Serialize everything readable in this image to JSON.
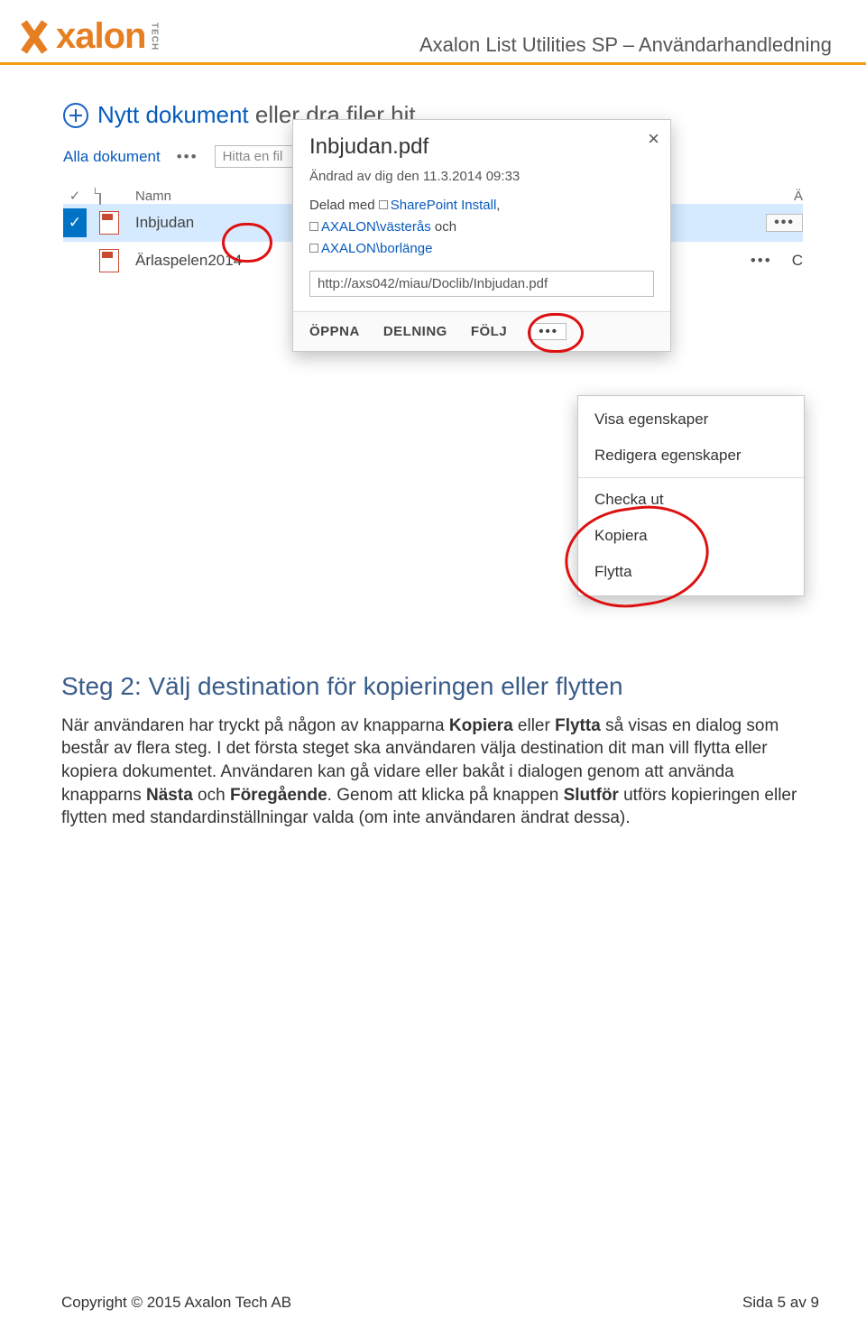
{
  "header": {
    "logo_text": "xalon",
    "logo_badge": "TECH",
    "title": "Axalon List Utilities SP – Användarhandledning"
  },
  "sp": {
    "new_doc_blue": "Nytt dokument",
    "new_doc_gray": " eller dra filer hit",
    "view_link": "Alla dokument",
    "search_placeholder": "Hitta en fil",
    "col_name": "Namn",
    "col_a": "Ä",
    "row1_name": "Inbjudan",
    "row2_name": "Ärlaspelen2014",
    "row2_a": "C"
  },
  "callout": {
    "title": "Inbjudan.pdf",
    "modified": "Ändrad av dig den 11.3.2014 09:33",
    "shared_label": "Delad med",
    "share1": "SharePoint Install",
    "share2": "AXALON\\västerås",
    "share_and": "och",
    "share3": "AXALON\\borlänge",
    "url": "http://axs042/miau/Doclib/Inbjudan.pdf",
    "act_open": "ÖPPNA",
    "act_share": "DELNING",
    "act_follow": "FÖLJ"
  },
  "menu": {
    "item1": "Visa egenskaper",
    "item2": "Redigera egenskaper",
    "item3": "Checka ut",
    "item4": "Kopiera",
    "item5": "Flytta"
  },
  "body": {
    "heading": "Steg 2: Välj destination för kopieringen eller flytten",
    "p1a": "När användaren har tryckt på någon av knapparna ",
    "p1b": "Kopiera",
    "p1c": " eller ",
    "p1d": "Flytta",
    "p1e": " så visas en dialog som består av flera steg. I det första steget ska användaren välja destination dit man vill flytta eller kopiera dokumentet. Användaren kan gå vidare eller bakåt i dialogen genom att använda knapparns ",
    "p1f": "Nästa",
    "p1g": " och ",
    "p1h": "Föregående",
    "p1i": ". Genom att klicka på knappen ",
    "p1j": "Slutför",
    "p1k": " utförs kopieringen eller flytten med standardinställningar valda (om inte användaren ändrat dessa)."
  },
  "footer": {
    "copyright": "Copyright © 2015 Axalon Tech AB",
    "page": "Sida 5 av 9"
  }
}
